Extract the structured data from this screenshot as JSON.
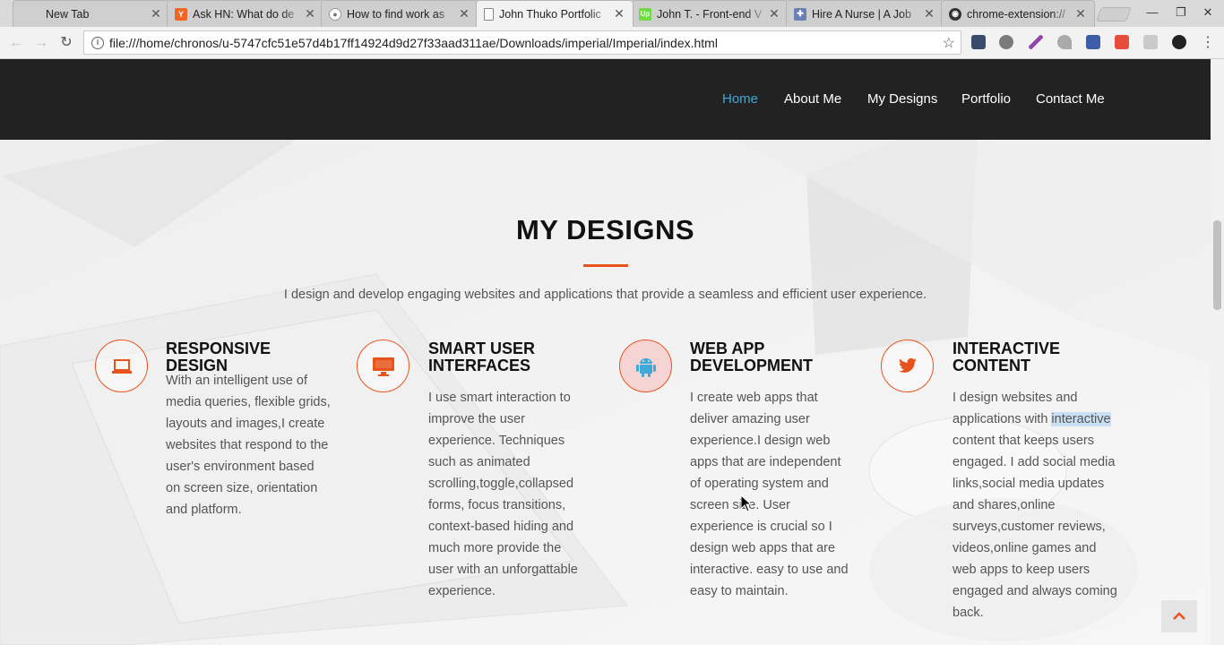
{
  "browser": {
    "tabs": [
      {
        "title": "New Tab",
        "favicon": "none"
      },
      {
        "title": "Ask HN: What do de",
        "favicon": "hacker-news-icon",
        "color": "#f26522",
        "glyph": "Y"
      },
      {
        "title": "How to find work as",
        "favicon": "reddit-icon",
        "color": "#777777",
        "glyph": "●"
      },
      {
        "title": "John Thuko Portfolic",
        "favicon": "document-icon",
        "active": true
      },
      {
        "title": "John T. - Front-end V",
        "favicon": "upwork-icon",
        "color": "#6fda44",
        "glyph": "Up"
      },
      {
        "title": "Hire A Nurse | A Job",
        "favicon": "nurse-icon",
        "color": "#6a7fb5",
        "glyph": "✚"
      },
      {
        "title": "chrome-extension://",
        "favicon": "extension-icon",
        "color": "#333333",
        "glyph": "◉"
      }
    ],
    "url": "file:///home/chronos/u-5747cfc51e57d4b17ff14924d9d27f33aad311ae/Downloads/imperial/Imperial/index.html"
  },
  "nav": {
    "links": [
      "Home",
      "About Me",
      "My Designs",
      "Portfolio",
      "Contact Me"
    ],
    "active_color": "#3fa9d8"
  },
  "section": {
    "title": "MY DESIGNS",
    "subtitle": "I design and develop engaging websites and applications that provide a seamless and efficient user experience.",
    "accent": "#e8531c",
    "features": [
      {
        "icon": "laptop-icon",
        "title": "RESPONSIVE DESIGN",
        "text": "With an intelligent use of media queries, flexible grids, layouts and images,I create websites that respond to the user's environment based on screen size, orientation and platform."
      },
      {
        "icon": "desktop-icon",
        "title": "SMART USER INTERFACES",
        "text": "I use smart interaction to improve the user experience. Techniques such as animated scrolling,toggle,collapsed forms, focus transitions, context-based hiding and much more provide the user with an unforgattable experience."
      },
      {
        "icon": "android-icon",
        "title": "WEB APP DEVELOPMENT",
        "text": "I create web apps that deliver amazing user experience.I design web apps that are independent of operating system and screen size. User experience is crucial so I design web apps that are interactive. easy to use and easy to maintain."
      },
      {
        "icon": "twitter-icon",
        "title": "INTERACTIVE CONTENT",
        "text_before": "I design websites and applications with ",
        "text_highlight": "interactive",
        "text_after": " content that keeps users engaged. I add social media links,social media updates and shares,online surveys,customer reviews, videos,online games and web apps to keep users engaged and always coming back."
      }
    ]
  }
}
